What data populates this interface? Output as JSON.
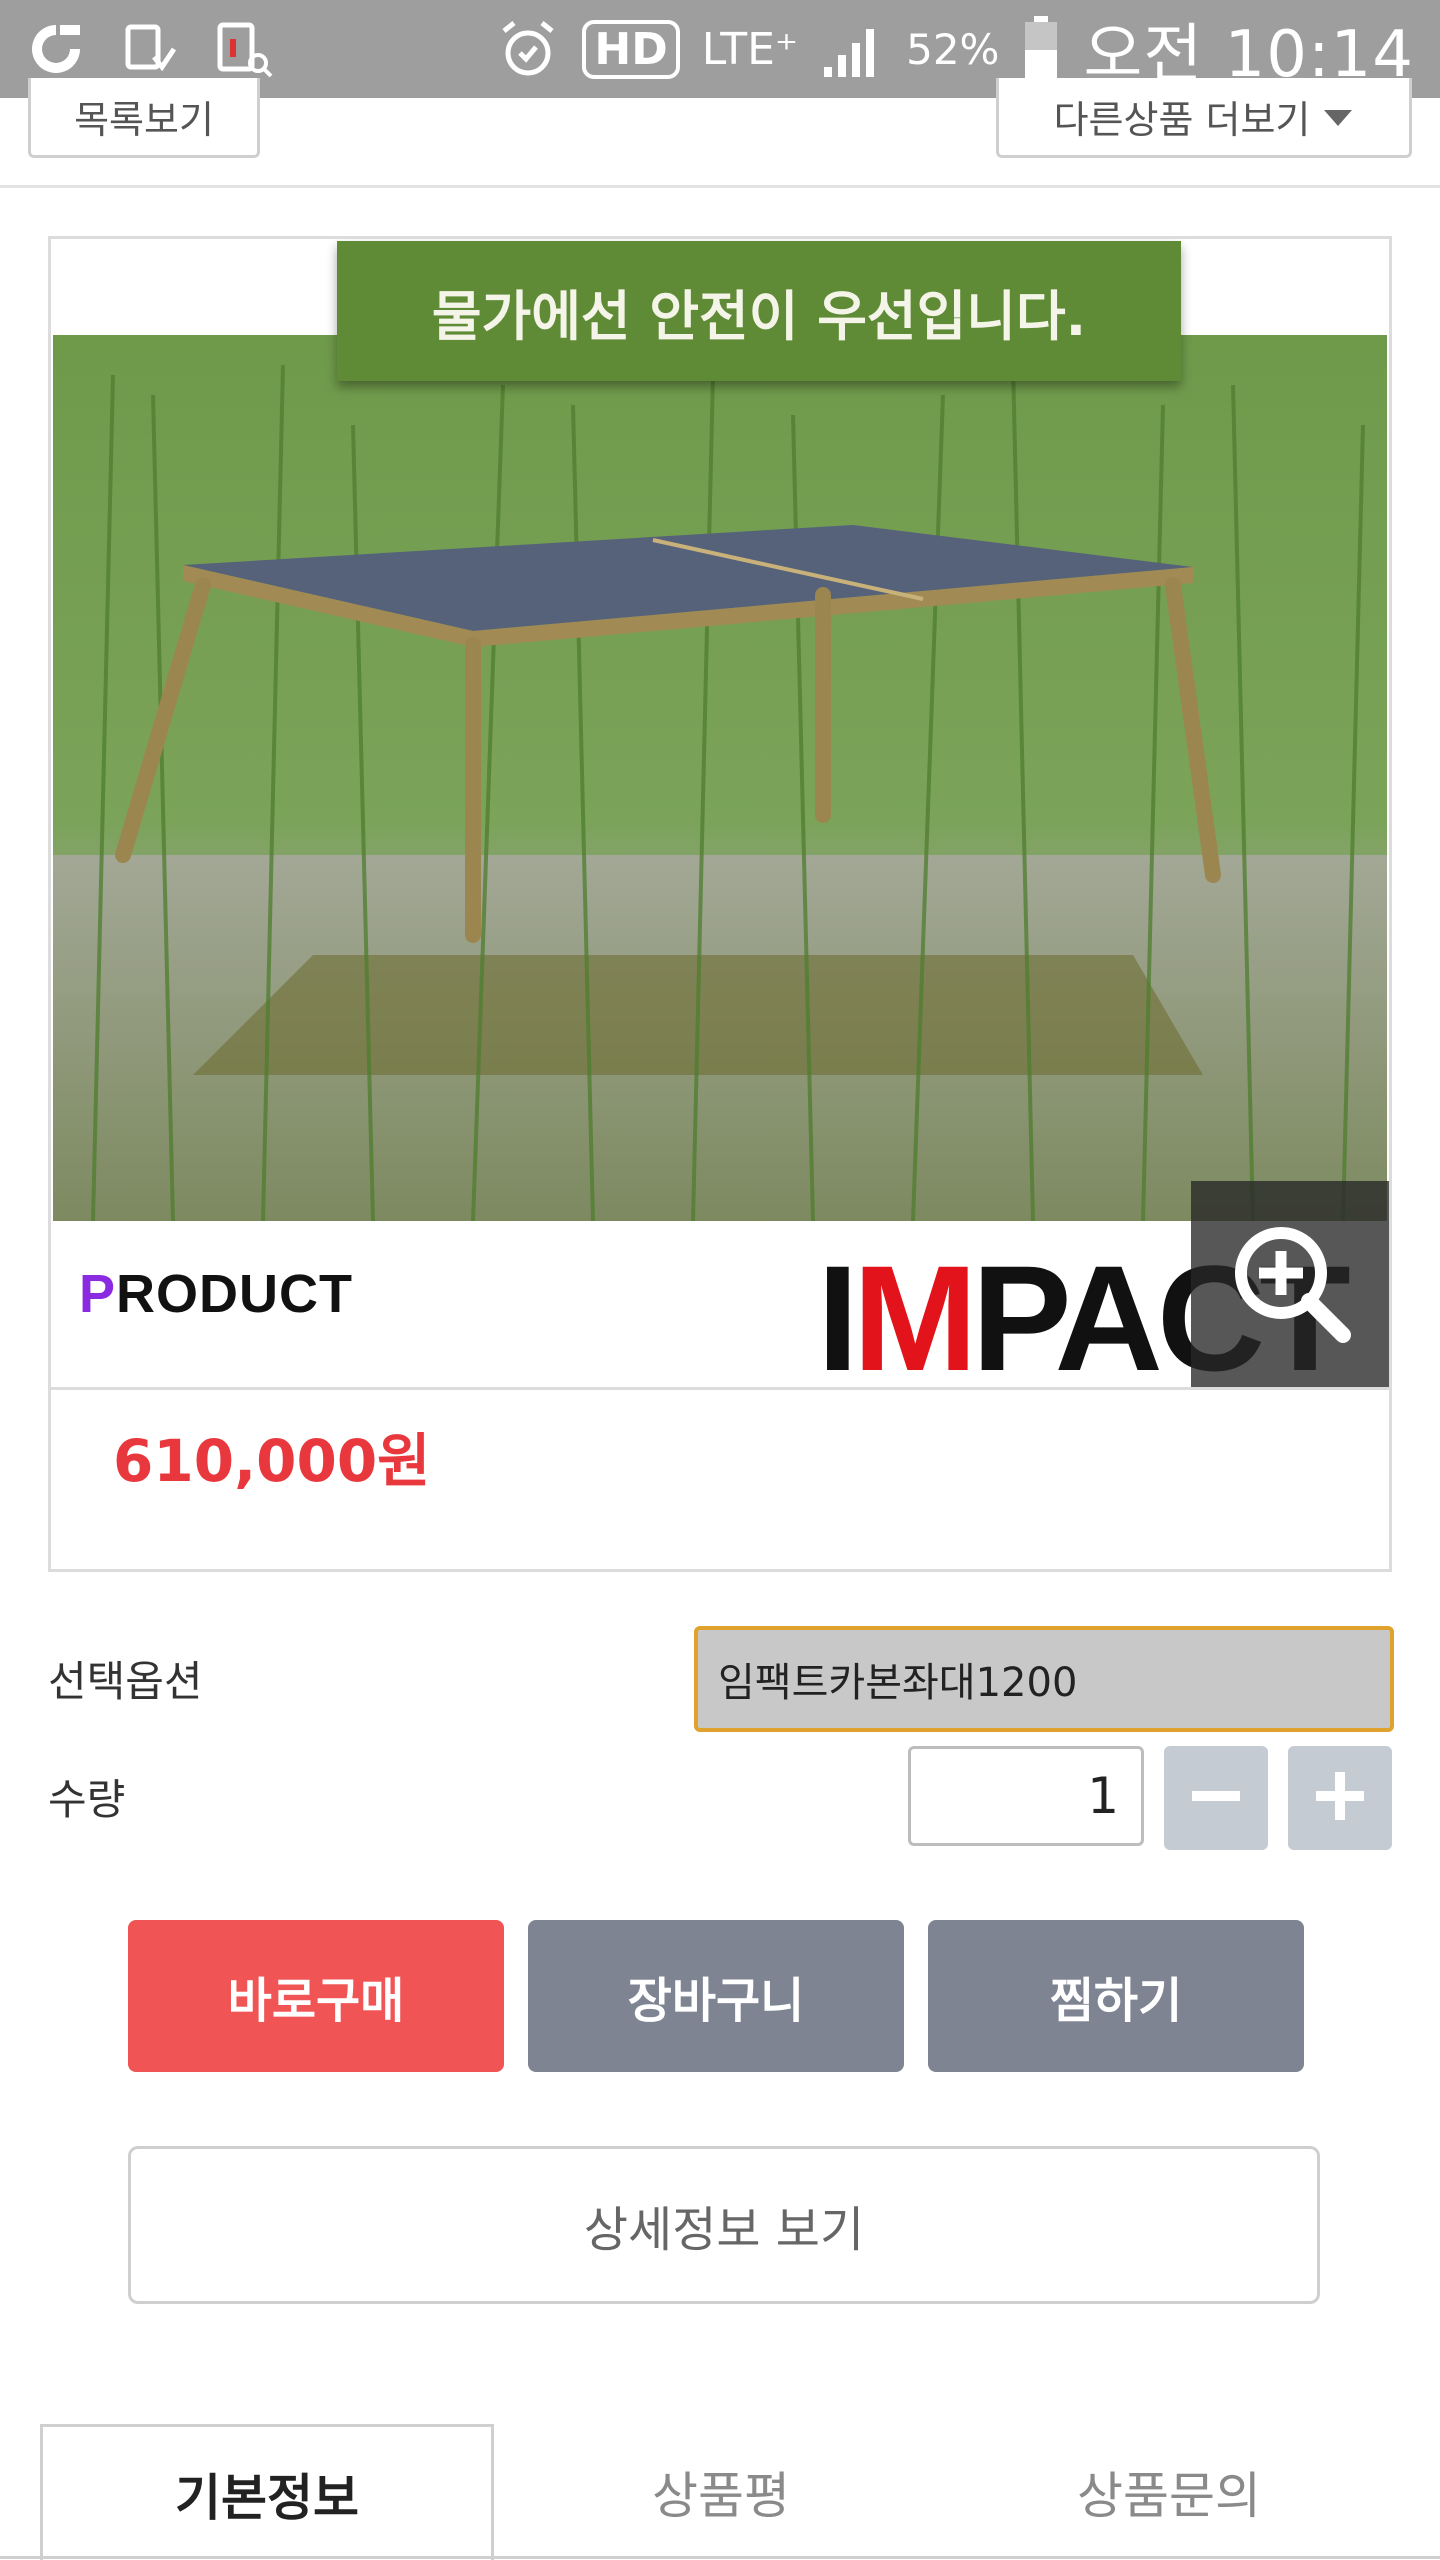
{
  "status_bar": {
    "lte": "LTE⁺",
    "hd": "HD",
    "battery": "52%",
    "time": "오전 10:14",
    "icons": [
      "carrier-logo-icon",
      "download-icon",
      "screenshot-icon",
      "alarm-icon",
      "hd-icon",
      "lte-icon",
      "signal-icon",
      "battery-icon"
    ]
  },
  "top_nav": {
    "left_label": "목록보기",
    "right_label": "다른상품 더보기"
  },
  "product": {
    "banner_text": "물가에선 안전이 우선입니다.",
    "brand_product_first": "P",
    "brand_product_rest": "RODUCT",
    "brand_impact_dark": "I",
    "brand_impact_red": "M",
    "brand_impact_rest": "PACT",
    "price": "610,000원",
    "zoom_icon": "zoom-in-icon"
  },
  "options": {
    "option_label": "선택옵션",
    "option_value": "임팩트카본좌대1200",
    "quantity_label": "수량",
    "quantity_value": "1"
  },
  "actions": {
    "buy_now": "바로구매",
    "cart": "장바구니",
    "wishlist": "찜하기",
    "detail": "상세정보 보기"
  },
  "tabs": [
    {
      "label": "기본정보",
      "active": true
    },
    {
      "label": "상품평",
      "active": false
    },
    {
      "label": "상품문의",
      "active": false
    }
  ],
  "colors": {
    "price": "#e8383d",
    "buy_button": "#f05454",
    "secondary_button": "#7f8492",
    "select_border": "#e1a12d",
    "banner": "#5f8a36"
  }
}
